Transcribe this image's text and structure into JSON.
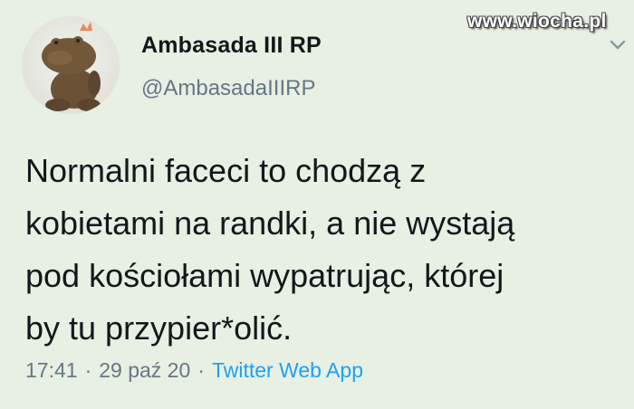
{
  "watermark": "www.wiocha.pl",
  "author": {
    "display_name": "Ambasada III RP",
    "handle": "@AmbasadaIIIRP",
    "avatar_icon": "frog-plush-avatar"
  },
  "tweet": {
    "lines": [
      "Normalni faceci to chodzą z",
      "kobietami na randki, a nie wystają",
      "pod kościołami wypatrując, której",
      "by tu przypier*olić."
    ]
  },
  "meta": {
    "time": "17:41",
    "separator": "·",
    "date": "29 paź 20",
    "source": "Twitter Web App"
  },
  "colors": {
    "background": "#e8efe3",
    "text": "#14171a",
    "secondary": "#657786",
    "link": "#1da1f2"
  }
}
